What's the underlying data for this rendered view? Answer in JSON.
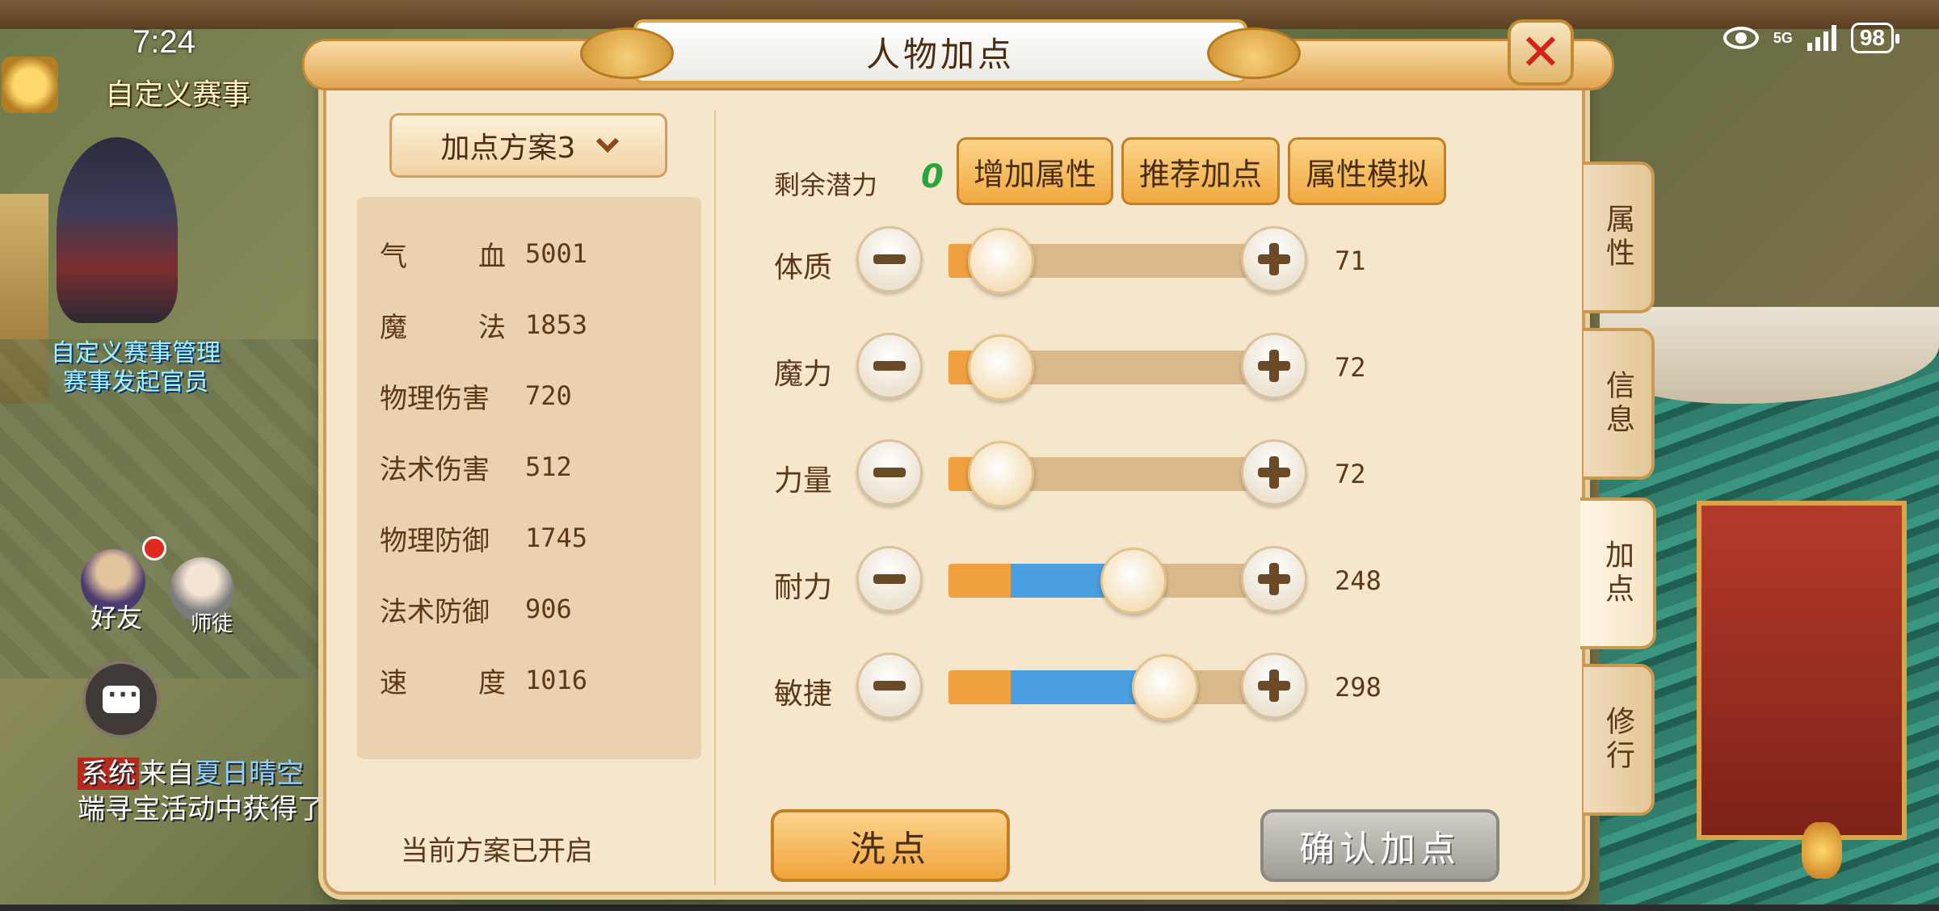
{
  "status_bar": {
    "time": "7:24",
    "network": "5G",
    "battery": "98"
  },
  "hud": {
    "custom_event": "自定义赛事",
    "npc_name_line1": "自定义赛事管理",
    "npc_name_line2": "赛事发起官员",
    "friend_label": "好友",
    "master_label": "师徒",
    "system_tag": "系统",
    "system_msg_part1": "来自",
    "system_msg_player": "夏日晴空",
    "system_msg_line2": "端寻宝活动中获得了"
  },
  "dialog": {
    "title": "人物加点",
    "scheme_select": "加点方案3",
    "scheme_status": "当前方案已开启",
    "potential_label": "剩余潜力",
    "potential_value": "0",
    "buttons": {
      "add_attr": "增加属性",
      "recommend": "推荐加点",
      "simulate": "属性模拟",
      "reset": "洗点",
      "confirm": "确认加点"
    },
    "stats": [
      {
        "name_a": "气",
        "name_b": "血",
        "value": "5001"
      },
      {
        "name_a": "魔",
        "name_b": "法",
        "value": "1853"
      },
      {
        "name": "物理伤害",
        "value": "720"
      },
      {
        "name": "法术伤害",
        "value": "512"
      },
      {
        "name": "物理防御",
        "value": "1745"
      },
      {
        "name": "法术防御",
        "value": "906"
      },
      {
        "name_a": "速",
        "name_b": "度",
        "value": "1016"
      }
    ],
    "attributes": [
      {
        "name": "体质",
        "value": "71",
        "base_fraction": 0.08,
        "added_fraction": 0.0,
        "handle_fraction": 0.08
      },
      {
        "name": "魔力",
        "value": "72",
        "base_fraction": 0.08,
        "added_fraction": 0.0,
        "handle_fraction": 0.08
      },
      {
        "name": "力量",
        "value": "72",
        "base_fraction": 0.08,
        "added_fraction": 0.0,
        "handle_fraction": 0.08
      },
      {
        "name": "耐力",
        "value": "248",
        "base_fraction": 0.18,
        "added_fraction": 0.28,
        "handle_fraction": 0.46
      },
      {
        "name": "敏捷",
        "value": "298",
        "base_fraction": 0.18,
        "added_fraction": 0.36,
        "handle_fraction": 0.55
      }
    ],
    "side_tabs": [
      "属性",
      "信息",
      "加点",
      "修行"
    ],
    "active_tab": "加点"
  },
  "colors": {
    "base_bar": "#f0a13f",
    "added_bar": "#4a9fe0",
    "potential_green": "#2aa53b",
    "close_red": "#d4231a"
  }
}
